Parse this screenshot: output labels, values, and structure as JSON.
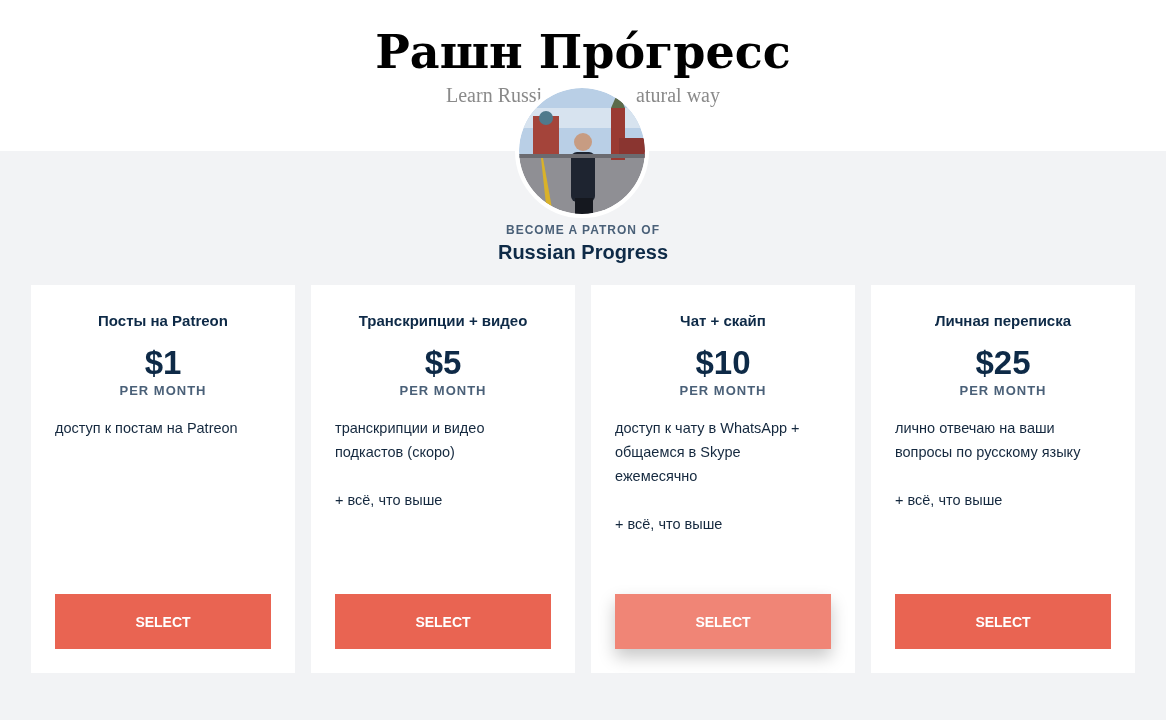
{
  "header": {
    "logo": "Рашн Прóгресс",
    "tagline_left": "Learn Russi",
    "tagline_right": "atural way"
  },
  "intro": {
    "eyebrow": "BECOME A PATRON OF",
    "name": "Russian Progress"
  },
  "tiers": [
    {
      "title": "Посты на Patreon",
      "price": "$1",
      "period": "PER MONTH",
      "description": [
        "доступ к постам на Patreon"
      ],
      "button": "SELECT",
      "hovered": false
    },
    {
      "title": "Транскрипции + видео",
      "price": "$5",
      "period": "PER MONTH",
      "description": [
        "транскрипции и видео подкастов (скоро)",
        "+ всё, что выше"
      ],
      "button": "SELECT",
      "hovered": false
    },
    {
      "title": "Чат + скайп",
      "price": "$10",
      "period": "PER MONTH",
      "description": [
        "доступ к чату в WhatsApp + общаемся в Skype ежемесячно",
        "+ всё, что выше"
      ],
      "button": "SELECT",
      "hovered": true
    },
    {
      "title": "Личная переписка",
      "price": "$25",
      "period": "PER MONTH",
      "description": [
        "лично отвечаю на ваши вопросы по русскому языку",
        "+ всё, что выше"
      ],
      "button": "SELECT",
      "hovered": false
    }
  ]
}
